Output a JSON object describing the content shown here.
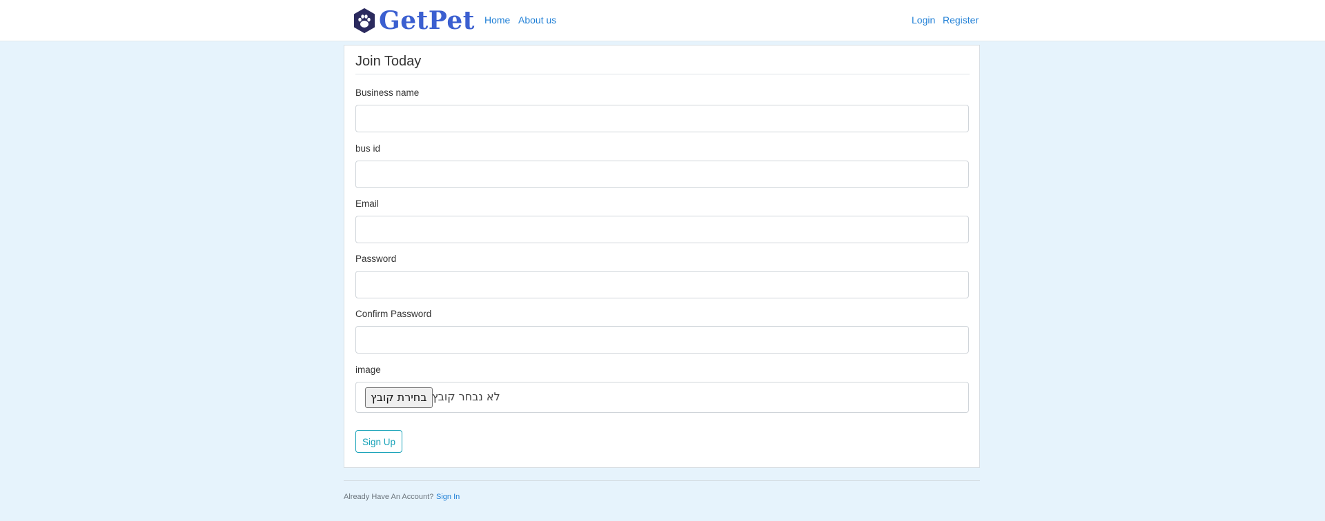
{
  "navbar": {
    "brand": "GetPet",
    "links": {
      "home": "Home",
      "about": "About us",
      "login": "Login",
      "register": "Register"
    }
  },
  "form": {
    "legend": "Join Today",
    "fields": {
      "business_name": {
        "label": "Business name",
        "value": ""
      },
      "bus_id": {
        "label": "bus id",
        "value": ""
      },
      "email": {
        "label": "Email",
        "value": ""
      },
      "password": {
        "label": "Password",
        "value": ""
      },
      "confirm_password": {
        "label": "Confirm Password",
        "value": ""
      },
      "image": {
        "label": "image",
        "button": "בחירת קובץ",
        "status": "לא נבחר קובץ"
      }
    },
    "submit": "Sign Up"
  },
  "footer": {
    "text": "Already Have An Account?",
    "link": "Sign In"
  },
  "colors": {
    "brand": "#3b5fd0",
    "logo_dark": "#2b2a5e",
    "link": "#1f7fd6",
    "accent": "#17a2b8",
    "background": "#e6f3fc"
  },
  "icons": {
    "logo": "paw-print-icon"
  }
}
